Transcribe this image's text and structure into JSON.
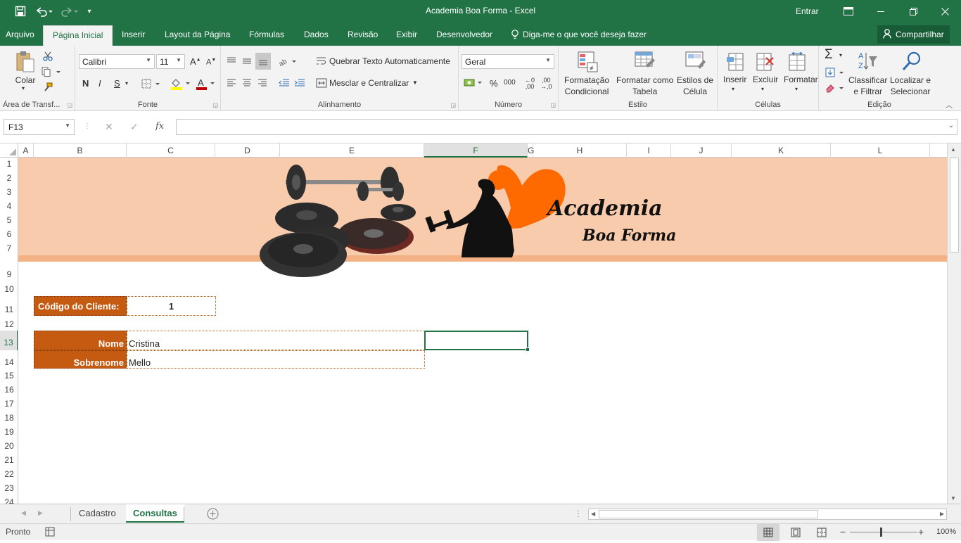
{
  "app": {
    "title": "Academia Boa Forma  -  Excel",
    "signin": "Entrar"
  },
  "tabs": [
    "Arquivo",
    "Página Inicial",
    "Inserir",
    "Layout da Página",
    "Fórmulas",
    "Dados",
    "Revisão",
    "Exibir",
    "Desenvolvedor"
  ],
  "tell_me": "Diga-me o que você deseja fazer",
  "share": "Compartilhar",
  "ribbon": {
    "clipboard": {
      "paste": "Colar",
      "label": "Área de Transf..."
    },
    "font": {
      "name": "Calibri",
      "size": "11",
      "bold": "N",
      "italic": "I",
      "underline": "S",
      "label": "Fonte"
    },
    "alignment": {
      "wrap": "Quebrar Texto Automaticamente",
      "merge": "Mesclar e Centralizar",
      "label": "Alinhamento"
    },
    "number": {
      "format": "Geral",
      "label": "Número"
    },
    "styles": {
      "conditional": "Formatação\nCondicional",
      "table": "Formatar como\nTabela",
      "cell": "Estilos de\nCélula",
      "label": "Estilo"
    },
    "cells": {
      "insert": "Inserir",
      "delete": "Excluir",
      "format": "Formatar",
      "label": "Células"
    },
    "editing": {
      "sort": "Classificar\ne Filtrar",
      "find": "Localizar e\nSelecionar",
      "label": "Edição"
    }
  },
  "namebox": "F13",
  "fx": "fx",
  "columns": [
    "A",
    "B",
    "C",
    "D",
    "E",
    "F",
    "G",
    "H",
    "I",
    "J",
    "K",
    "L"
  ],
  "rows": [
    "1",
    "2",
    "3",
    "4",
    "5",
    "6",
    "7",
    "9",
    "10",
    "11",
    "12",
    "13",
    "14",
    "15",
    "16",
    "17",
    "18",
    "19",
    "20",
    "21",
    "22",
    "23",
    "24"
  ],
  "logo": {
    "line1": "Academia",
    "line2": "Boa Forma"
  },
  "form": {
    "code_label": "Código do Cliente:",
    "code_value": "1",
    "name_label": "Nome",
    "name_value": "Cristina",
    "surname_label": "Sobrenome",
    "surname_value": "Mello"
  },
  "sheets": [
    "Cadastro",
    "Consultas"
  ],
  "status": {
    "ready": "Pronto",
    "zoom": "100%"
  },
  "colors": {
    "excel_green": "#217346",
    "banner": "#f7cbab",
    "band": "#f4b183",
    "label_bg": "#c55a11",
    "logo_orange": "#ff6a00"
  }
}
